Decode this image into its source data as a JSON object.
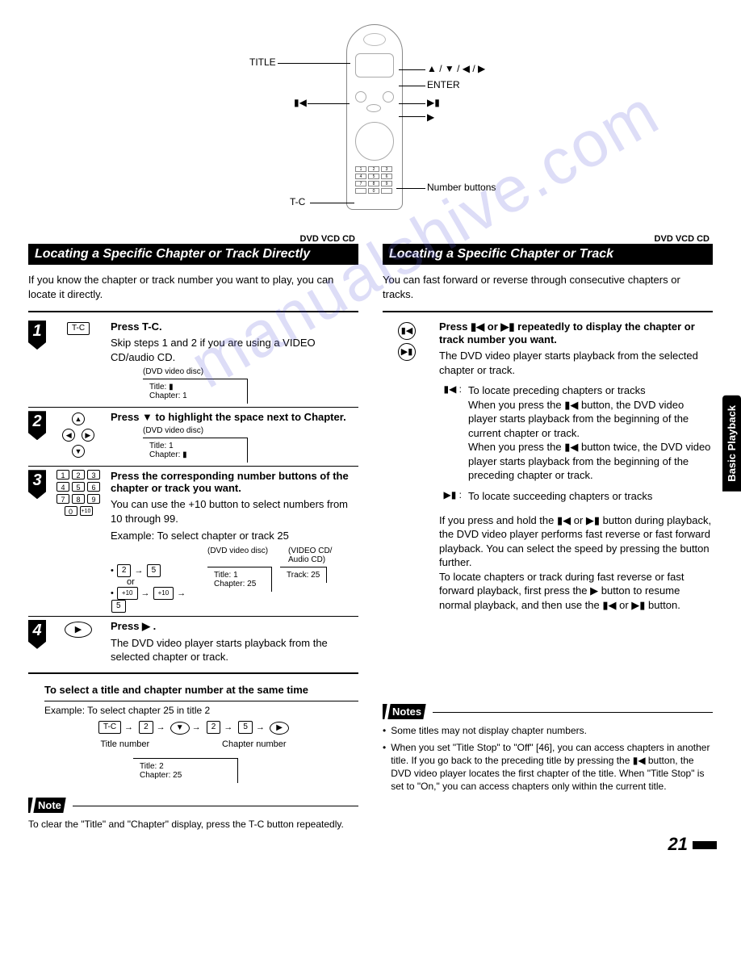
{
  "remote": {
    "labels": {
      "title": "TITLE",
      "arrows": "▲ / ▼ / ◀ / ▶",
      "enter": "ENTER",
      "prev": "▮◀",
      "next": "▶▮",
      "play": "▶",
      "number_buttons": "Number buttons",
      "tc": "T-C"
    }
  },
  "disc_badges_left": "DVD   VCD   CD",
  "disc_badges_right": "DVD   VCD   CD",
  "left": {
    "header": "Locating a Specific Chapter or Track Directly",
    "intro": "If you know the chapter or track number you want to play, you can locate it directly.",
    "step1": {
      "num": "1",
      "btn": "T-C",
      "title": "Press T-C.",
      "text": "Skip steps 1 and 2 if you are using a VIDEO CD/audio CD.",
      "osd_caption": "(DVD video disc)",
      "osd_line1": "Title: ▮",
      "osd_line2": "Chapter:   1"
    },
    "step2": {
      "num": "2",
      "title": "Press ▼ to highlight the space next to Chapter.",
      "osd_caption": "(DVD video disc)",
      "osd_line1": "Title:   1",
      "osd_line2": "Chapter: ▮"
    },
    "step3": {
      "num": "3",
      "title": "Press the corresponding number buttons of the chapter or track you want.",
      "text1": "You can use the +10 button to select numbers from 10 through 99.",
      "example_label": "Example: To select chapter or track 25",
      "col_dvd": "(DVD video disc)",
      "col_vcd": "(VIDEO CD/\nAudio CD)",
      "seq1_a": "2",
      "seq1_b": "5",
      "or": "or",
      "seq2_a": "+10",
      "seq2_b": "+10",
      "seq2_c": "5",
      "osd_dvd_l1": "Title:   1",
      "osd_dvd_l2": "Chapter: 25",
      "osd_vcd": "Track: 25"
    },
    "step4": {
      "num": "4",
      "title": "Press ▶ .",
      "text": "The DVD video player starts playback from the selected chapter or track."
    },
    "subsection_title": "To select a title and chapter number at the same time",
    "example2": "Example:  To select chapter 25 in title 2",
    "seq3": {
      "a": "T-C",
      "b": "2",
      "c": "▼",
      "d": "2",
      "e": "5",
      "f": "▶"
    },
    "seq3_label_title": "Title number",
    "seq3_label_chapter": "Chapter number",
    "seq3_osd_l1": "Title:   2",
    "seq3_osd_l2": "Chapter: 25",
    "note_label": "Note",
    "note_text": "To clear the \"Title\" and \"Chapter\" display, press the T-C button repeatedly."
  },
  "right": {
    "header": "Locating a Specific Chapter or Track",
    "intro": "You can fast forward or reverse through consecutive chapters or tracks.",
    "step": {
      "title": "Press ▮◀ or ▶▮ repeatedly to display the chapter or track number you want.",
      "text1": "The DVD video player starts playback from the selected chapter or track.",
      "prev_sym": "▮◀ :",
      "prev_text": "To locate preceding chapters or tracks\nWhen you press the ▮◀ button, the DVD video player starts playback from the beginning of the current chapter or track.\nWhen you press the ▮◀ button twice, the DVD video player starts playback from the beginning of the preceding chapter or track.",
      "next_sym": "▶▮ :",
      "next_text": "To locate succeeding chapters or tracks",
      "para2": "If you press and hold the ▮◀ or ▶▮ button during playback, the DVD video player performs fast reverse or fast forward playback. You can select the speed by pressing the button further.\nTo locate chapters or track during fast reverse or fast forward playback, first press the ▶ button to resume normal playback, and then use the ▮◀ or ▶▮ button."
    },
    "notes_label": "Notes",
    "notes": [
      "Some titles may not display chapter numbers.",
      "When you set \"Title Stop\" to \"Off\" [46], you can access chapters in another title. If you go back to the preceding title by pressing the ▮◀ button, the DVD video player locates the first chapter of the title.  When \"Title Stop\" is set to \"On,\" you can access chapters only within the current title."
    ]
  },
  "side_tab": "Basic Playback",
  "page_number": "21"
}
